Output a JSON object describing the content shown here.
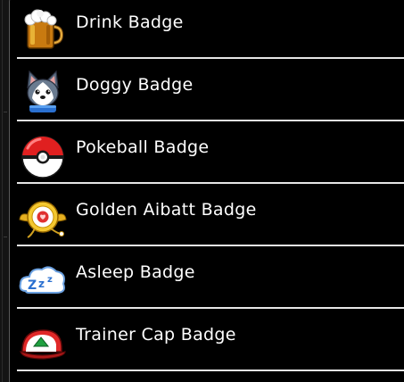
{
  "menu": {
    "items": [
      {
        "label": "Drink Badge",
        "icon": "beer-mug-icon"
      },
      {
        "label": "Doggy Badge",
        "icon": "husky-dog-icon"
      },
      {
        "label": "Pokeball Badge",
        "icon": "pokeball-icon"
      },
      {
        "label": "Golden Aibatt Badge",
        "icon": "golden-aibatt-icon"
      },
      {
        "label": "Asleep Badge",
        "icon": "sleep-cloud-icon"
      },
      {
        "label": "Trainer Cap Badge",
        "icon": "trainer-cap-icon"
      }
    ]
  },
  "colors": {
    "background": "#000000",
    "text": "#ffffff",
    "divider": "#e6e6e6"
  }
}
